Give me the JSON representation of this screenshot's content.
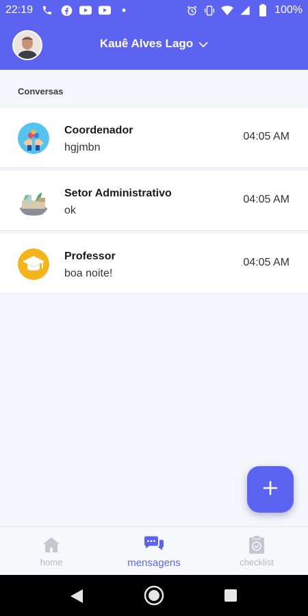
{
  "status_bar": {
    "time": "22:19",
    "battery": "100%",
    "left_icons": [
      "phone-icon",
      "facebook-icon",
      "youtube-icon",
      "youtube-icon",
      "dot-icon"
    ],
    "right_icons": [
      "alarm-icon",
      "vibrate-icon",
      "wifi-icon",
      "signal-icon",
      "battery-icon"
    ]
  },
  "header": {
    "user_name": "Kauê Alves Lago",
    "background": "#5b63f0"
  },
  "section": {
    "title": "Conversas"
  },
  "conversations": [
    {
      "name": "Coordenador",
      "last_message": "hgjmbn",
      "time": "04:05 AM",
      "icon": "coordinator-icon"
    },
    {
      "name": "Setor Administrativo",
      "last_message": "ok",
      "time": "04:05 AM",
      "icon": "office-icon"
    },
    {
      "name": "Professor",
      "last_message": "boa noite!",
      "time": "04:05 AM",
      "icon": "graduation-cap-icon"
    }
  ],
  "fab": {
    "icon": "plus-icon"
  },
  "bottom_nav": {
    "items": [
      {
        "label": "home",
        "icon": "home-icon",
        "active": false
      },
      {
        "label": "mensagens",
        "icon": "chat-bubbles-icon",
        "active": true
      },
      {
        "label": "checklist",
        "icon": "clipboard-check-icon",
        "active": false
      }
    ]
  },
  "android_nav": {
    "buttons": [
      "back-icon",
      "home-circle-icon",
      "recents-icon"
    ]
  }
}
